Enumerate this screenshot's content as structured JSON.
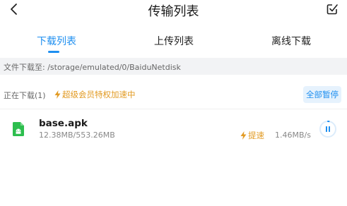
{
  "header": {
    "title": "传输列表",
    "back_icon": "chevron-left-icon",
    "select_icon": "multi-select-edit-icon"
  },
  "tabs": [
    {
      "label": "下载列表",
      "active": true
    },
    {
      "label": "上传列表",
      "active": false
    },
    {
      "label": "离线下载",
      "active": false
    }
  ],
  "path_bar": {
    "text": "文件下载至: /storage/emulated/0/BaiduNetdisk"
  },
  "status": {
    "label": "正在下载(1)",
    "vip_text": "超级会员特权加速中",
    "pause_all_label": "全部暂停"
  },
  "files": [
    {
      "name": "base.apk",
      "size": "12.38MB/553.26MB",
      "speedup_label": "提速",
      "speed": "1.46MB/s",
      "progress_fraction": 0.022,
      "file_icon": "android-file-icon",
      "action_icon": "pause-icon"
    }
  ],
  "colors": {
    "accent": "#1e8ff0",
    "vip": "#e29b24",
    "file_icon": "#2dbe4e",
    "path_bg": "#f2f3f5"
  }
}
